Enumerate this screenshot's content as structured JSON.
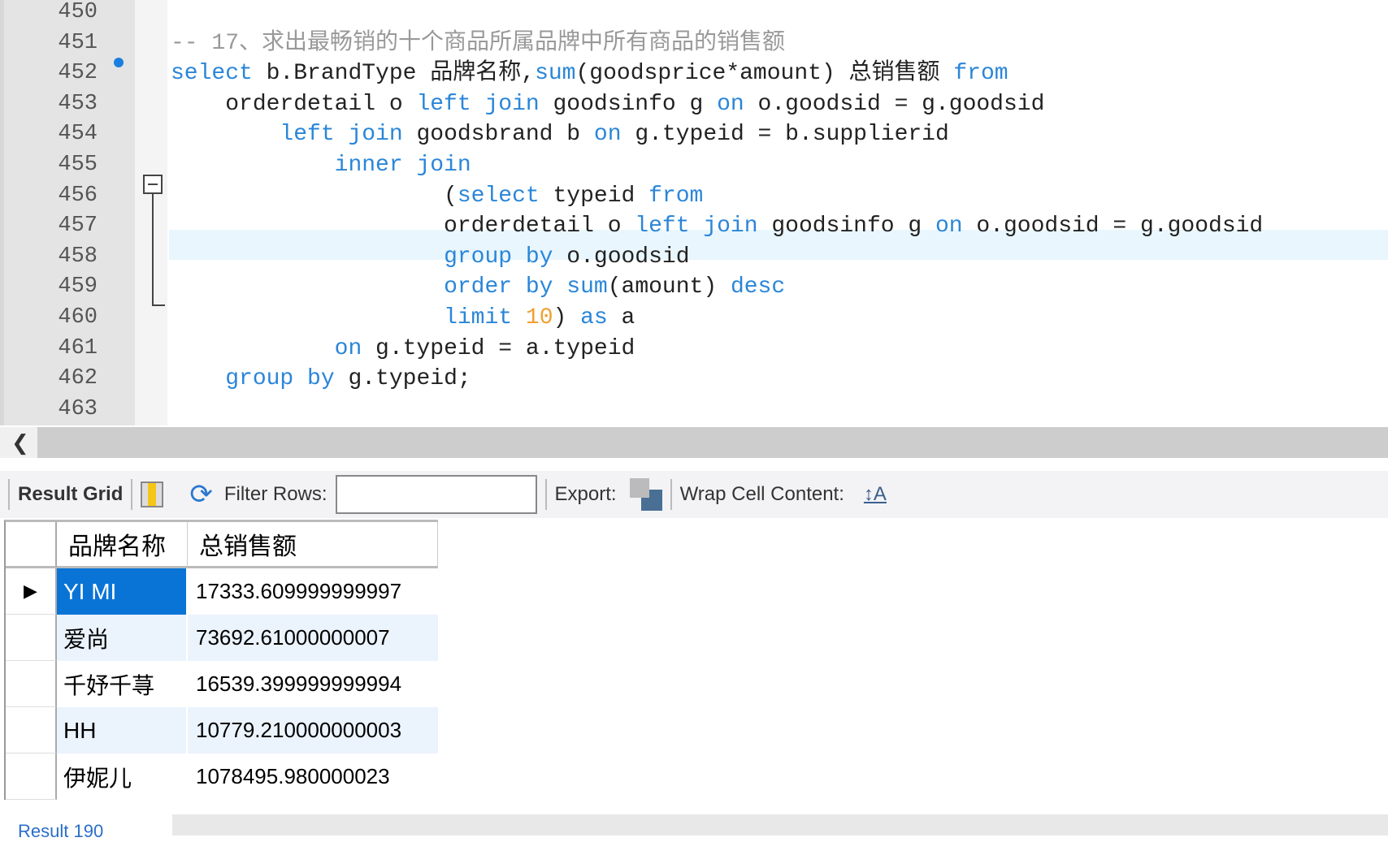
{
  "editor": {
    "line_numbers": [
      "450",
      "451",
      "452",
      "453",
      "454",
      "455",
      "456",
      "457",
      "458",
      "459",
      "460",
      "461",
      "462",
      "463"
    ],
    "lines": [
      [
        {
          "t": "-- 17、求出最畅销的十个商品所属品牌中所有商品的销售额",
          "c": "cm"
        }
      ],
      [
        {
          "t": "select",
          "c": "kw"
        },
        {
          "t": " b.BrandType 品牌名称,"
        },
        {
          "t": "sum",
          "c": "kw"
        },
        {
          "t": "(goodsprice*amount) 总销售额 "
        },
        {
          "t": "from",
          "c": "kw"
        }
      ],
      [
        {
          "t": "    orderdetail o "
        },
        {
          "t": "left join",
          "c": "kw"
        },
        {
          "t": " goodsinfo g "
        },
        {
          "t": "on",
          "c": "kw"
        },
        {
          "t": " o.goodsid = g.goodsid"
        }
      ],
      [
        {
          "t": "        "
        },
        {
          "t": "left join",
          "c": "kw"
        },
        {
          "t": " goodsbrand b "
        },
        {
          "t": "on",
          "c": "kw"
        },
        {
          "t": " g.typeid = b.supplierid"
        }
      ],
      [
        {
          "t": "            "
        },
        {
          "t": "inner join",
          "c": "kw"
        }
      ],
      [
        {
          "t": "                    ("
        },
        {
          "t": "select",
          "c": "kw"
        },
        {
          "t": " typeid "
        },
        {
          "t": "from",
          "c": "kw"
        }
      ],
      [
        {
          "t": "                    orderdetail o "
        },
        {
          "t": "left join",
          "c": "kw"
        },
        {
          "t": " goodsinfo g "
        },
        {
          "t": "on",
          "c": "kw"
        },
        {
          "t": " o.goodsid = g.goodsid"
        }
      ],
      [
        {
          "t": "                    "
        },
        {
          "t": "group by",
          "c": "kw"
        },
        {
          "t": " o.goodsid"
        }
      ],
      [
        {
          "t": "                    "
        },
        {
          "t": "order by",
          "c": "kw"
        },
        {
          "t": " "
        },
        {
          "t": "sum",
          "c": "kw"
        },
        {
          "t": "(amount) "
        },
        {
          "t": "desc",
          "c": "kw"
        }
      ],
      [
        {
          "t": "                    "
        },
        {
          "t": "limit",
          "c": "kw"
        },
        {
          "t": " "
        },
        {
          "t": "10",
          "c": "num"
        },
        {
          "t": ") "
        },
        {
          "t": "as",
          "c": "kw"
        },
        {
          "t": " a"
        }
      ],
      [
        {
          "t": "            "
        },
        {
          "t": "on",
          "c": "kw"
        },
        {
          "t": " g.typeid = a.typeid"
        }
      ],
      [
        {
          "t": "    "
        },
        {
          "t": "group by",
          "c": "kw"
        },
        {
          "t": " g.typeid;"
        }
      ],
      []
    ]
  },
  "toolbar": {
    "result_grid": "Result Grid",
    "filter_rows": "Filter Rows:",
    "filter_value": "",
    "export": "Export:",
    "wrap": "Wrap Cell Content:"
  },
  "grid": {
    "columns": [
      "品牌名称",
      "总销售额"
    ],
    "rows": [
      [
        "YI MI",
        "17333.609999999997"
      ],
      [
        "爱尚",
        "73692.61000000007"
      ],
      [
        "千妤千荨",
        "16539.399999999994"
      ],
      [
        "HH",
        "10779.210000000003"
      ],
      [
        "伊妮儿",
        "1078495.980000023"
      ]
    ]
  },
  "tabs": {
    "result": "Result 190"
  }
}
